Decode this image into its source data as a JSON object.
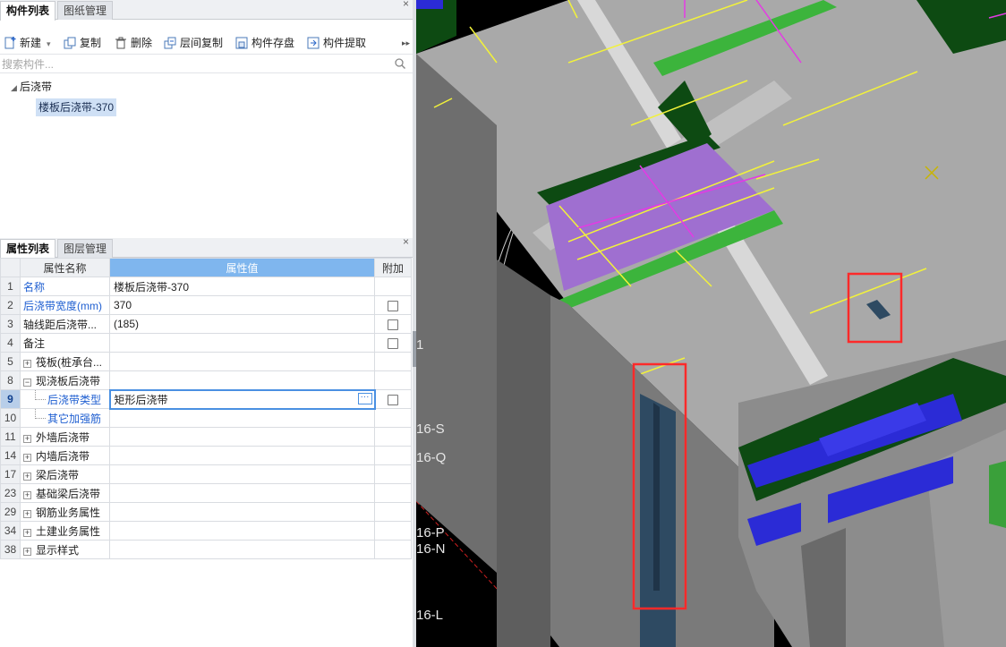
{
  "component_panel": {
    "tabs": [
      "构件列表",
      "图纸管理"
    ],
    "active_tab": 0
  },
  "toolbar": {
    "new": "新建",
    "copy": "复制",
    "delete": "删除",
    "floor_copy": "层间复制",
    "save": "构件存盘",
    "extract": "构件提取",
    "more": "▸▸"
  },
  "search": {
    "placeholder": "搜索构件..."
  },
  "tree": {
    "parent": "后浇带",
    "child": "楼板后浇带-370"
  },
  "property_panel": {
    "tabs": [
      "属性列表",
      "图层管理"
    ],
    "active_tab": 0,
    "headers": {
      "name": "属性名称",
      "value": "属性值",
      "extra": "附加"
    },
    "rows": [
      {
        "num": "1",
        "name": "名称",
        "value": "楼板后浇带-370",
        "checkbox": false,
        "style": "blue"
      },
      {
        "num": "2",
        "name": "后浇带宽度(mm)",
        "value": "370",
        "checkbox": true,
        "style": "blue"
      },
      {
        "num": "3",
        "name": "轴线距后浇带...",
        "value": "(185)",
        "checkbox": true,
        "style": "plain"
      },
      {
        "num": "4",
        "name": "备注",
        "value": "",
        "checkbox": true,
        "style": "plain"
      },
      {
        "num": "5",
        "name": "筏板(桩承台...",
        "value": "",
        "checkbox": false,
        "style": "plus"
      },
      {
        "num": "8",
        "name": "现浇板后浇带",
        "value": "",
        "checkbox": false,
        "style": "minus"
      },
      {
        "num": "9",
        "name": "后浇带类型",
        "value": "矩形后浇带",
        "checkbox": true,
        "style": "child-selected"
      },
      {
        "num": "10",
        "name": "其它加强筋",
        "value": "",
        "checkbox": false,
        "style": "child"
      },
      {
        "num": "11",
        "name": "外墙后浇带",
        "value": "",
        "checkbox": false,
        "style": "plus"
      },
      {
        "num": "14",
        "name": "内墙后浇带",
        "value": "",
        "checkbox": false,
        "style": "plus"
      },
      {
        "num": "17",
        "name": "梁后浇带",
        "value": "",
        "checkbox": false,
        "style": "plus"
      },
      {
        "num": "23",
        "name": "基础梁后浇带",
        "value": "",
        "checkbox": false,
        "style": "plus"
      },
      {
        "num": "29",
        "name": "钢筋业务属性",
        "value": "",
        "checkbox": false,
        "style": "plus"
      },
      {
        "num": "34",
        "name": "土建业务属性",
        "value": "",
        "checkbox": false,
        "style": "plus"
      },
      {
        "num": "38",
        "name": "显示样式",
        "value": "",
        "checkbox": false,
        "style": "plus"
      }
    ]
  },
  "viewport": {
    "axis_labels": [
      "1",
      "16-S",
      "16-Q",
      "16-P",
      "16-N",
      "16-L"
    ],
    "colors": {
      "background": "#000000",
      "slab": "#a9a9a9",
      "beam_green": "#0d4a12",
      "highlight_green": "#3cb43c",
      "purple_slab": "#9f6fd0",
      "column_blue": "#2b2bd6",
      "rebar_yellow": "#f2f23a",
      "rebar_magenta": "#e43ae4",
      "red_box": "#ff2a2a"
    }
  }
}
